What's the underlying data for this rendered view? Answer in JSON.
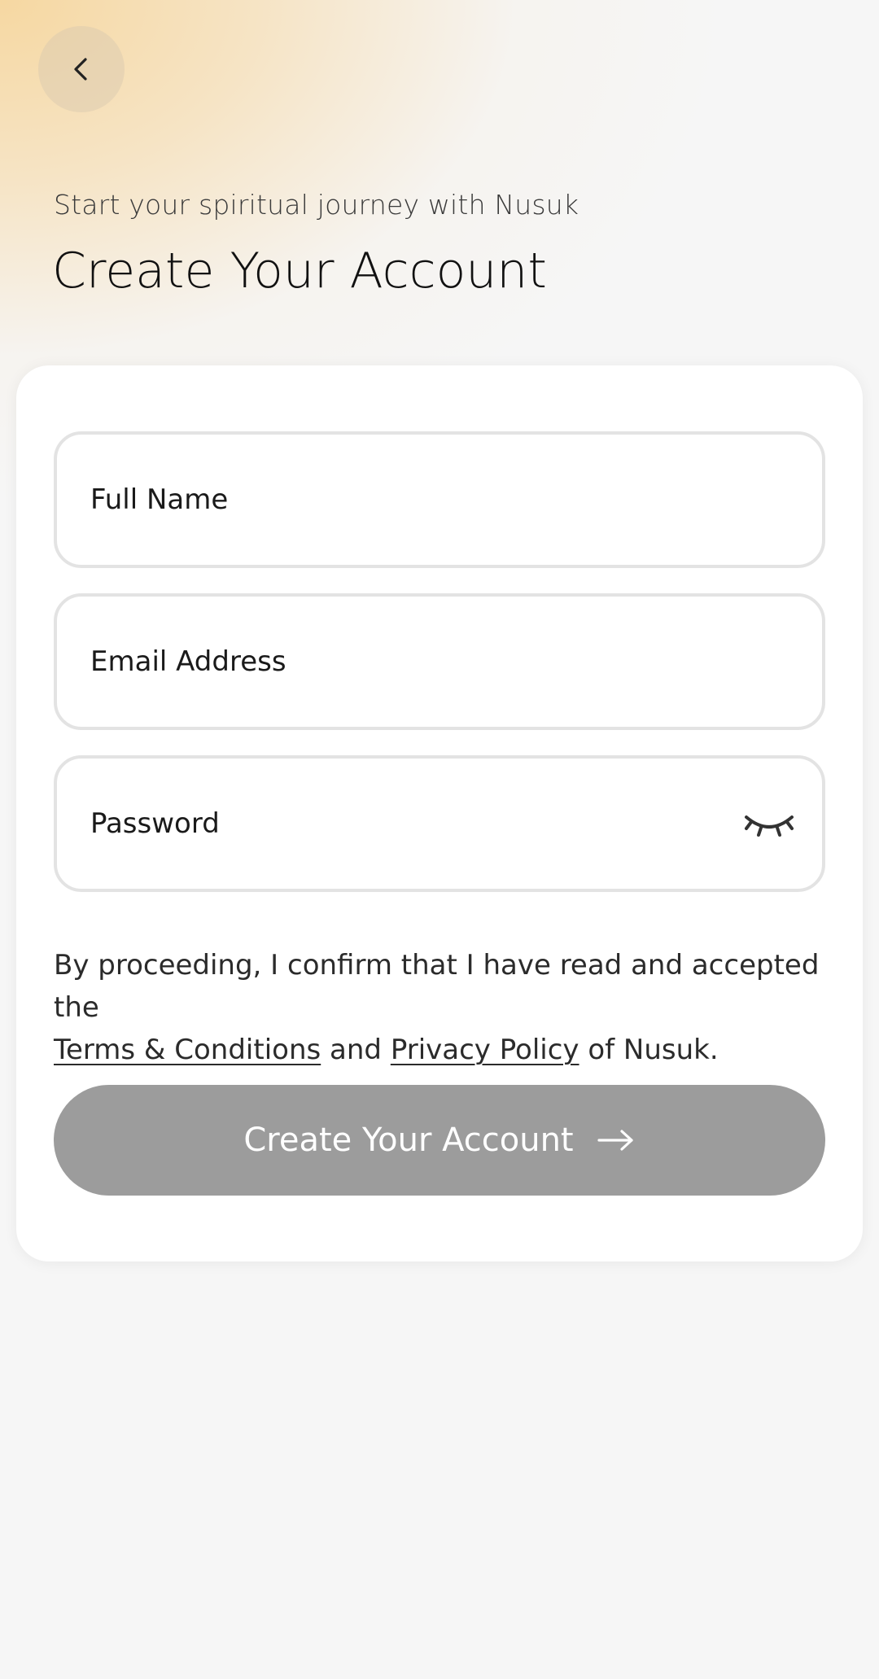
{
  "header": {
    "back_icon": "chevron-left-icon",
    "subtitle": "Start your spiritual journey with Nusuk",
    "title": "Create Your Account"
  },
  "form": {
    "full_name": {
      "placeholder": "Full Name",
      "value": ""
    },
    "email": {
      "placeholder": "Email Address",
      "value": ""
    },
    "password": {
      "placeholder": "Password",
      "value": "",
      "toggle_icon": "eye-closed-icon"
    },
    "terms": {
      "prefix": "By proceeding, I confirm that I have read and accepted the",
      "terms_link": "Terms & Conditions",
      "and": "and",
      "privacy_link": "Privacy Policy",
      "suffix": "of Nusuk."
    },
    "submit": {
      "label": "Create Your Account",
      "icon": "arrow-right-icon",
      "disabled": true
    }
  },
  "colors": {
    "background": "#f6f6f6",
    "hero_gradient": "#f6d69d",
    "card": "#ffffff",
    "field_border": "#e3e3e3",
    "button_disabled": "#9c9c9c",
    "text": "#111111"
  }
}
